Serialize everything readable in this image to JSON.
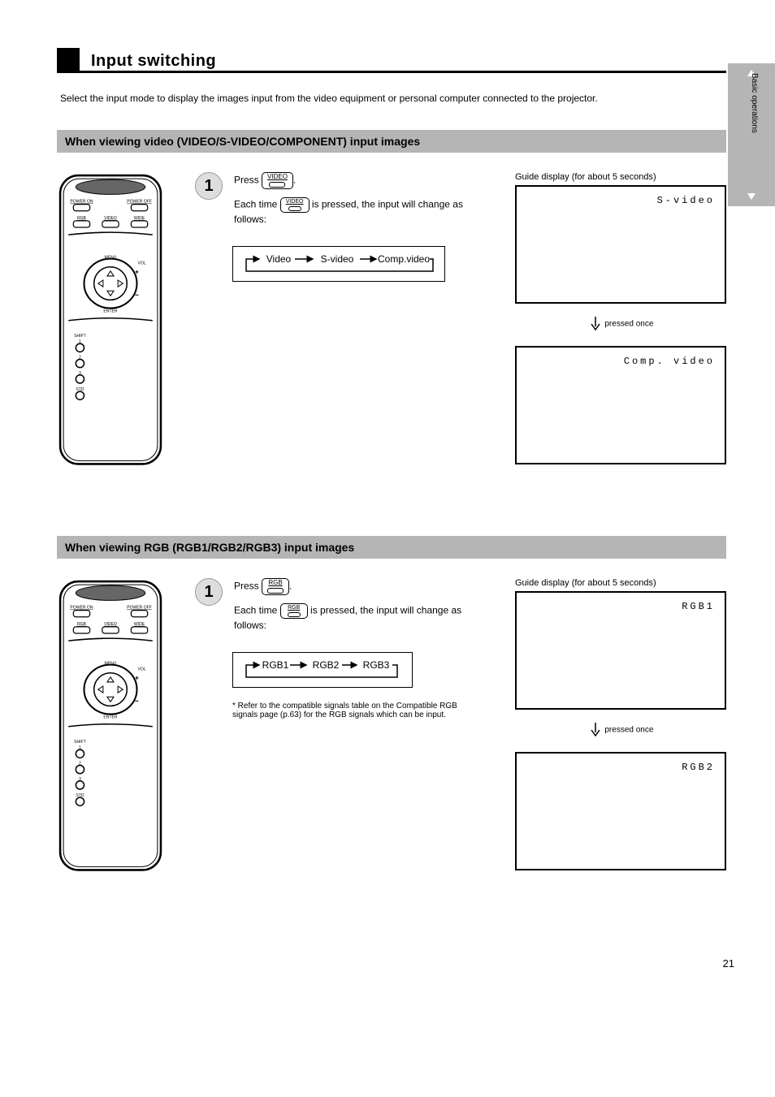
{
  "side_tab": {
    "label": "Basic operations"
  },
  "header": {
    "title": "Input switching"
  },
  "intro": "Select the input mode to display the images input from the video equipment or personal computer connected to the projector.",
  "sections": [
    {
      "header": "When viewing video (VIDEO/S-VIDEO/COMPONENT) input images",
      "button_key": "VIDEO",
      "step": {
        "num": "1",
        "line1_pre": "Press ",
        "line1_post": ".",
        "line2_pre": "Each time ",
        "line2_post": " is pressed, the input will change as follows:"
      },
      "cycle": [
        "Video",
        "S-video",
        "Comp.video"
      ],
      "screens": [
        {
          "label": "S-video"
        },
        {
          "label": "Comp. video"
        }
      ],
      "guide_caption": "Guide display (for about 5 seconds)",
      "arrow_text": "pressed once"
    },
    {
      "header": "When viewing RGB (RGB1/RGB2/RGB3) input images",
      "button_key": "RGB",
      "step": {
        "num": "1",
        "line1_pre": "Press ",
        "line1_post": ".",
        "line2_pre": "Each time ",
        "line2_post": " is pressed, the input will change as follows:"
      },
      "cycle": [
        "RGB1",
        "RGB2",
        "RGB3"
      ],
      "screens": [
        {
          "label": "RGB1"
        },
        {
          "label": "RGB2"
        }
      ],
      "guide_caption": "Guide display (for about 5 seconds)",
      "arrow_text": "pressed once",
      "note": "* Refer to the compatible signals table on the Compatible RGB signals page (p.63) for the RGB signals which can be input."
    }
  ],
  "page_number": "21"
}
